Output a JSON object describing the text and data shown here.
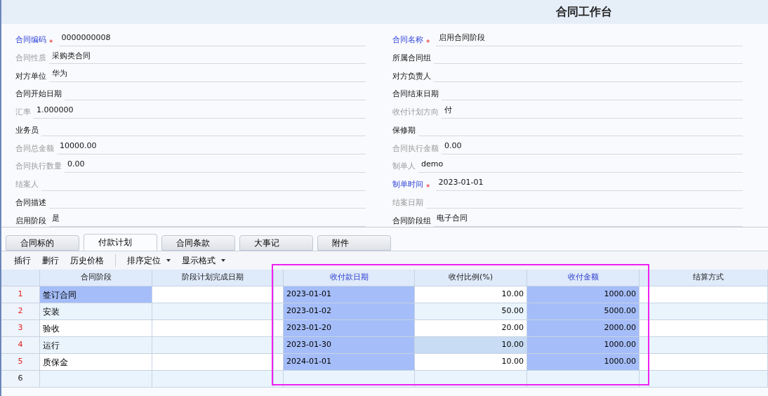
{
  "window": {
    "title": "合同工作台"
  },
  "form": {
    "left": [
      {
        "label": "合同编码",
        "kind": "required",
        "mark": "*",
        "value": "0000000008"
      },
      {
        "label": "合同性质",
        "kind": "readonly",
        "value": "采购类合同"
      },
      {
        "label": "对方单位",
        "kind": "normal",
        "value": "华为"
      },
      {
        "label": "合同开始日期",
        "kind": "normal"
      },
      {
        "label": "汇率",
        "kind": "readonly",
        "value": "1.000000"
      },
      {
        "label": "业务员",
        "kind": "normal"
      },
      {
        "label": "合同总金额",
        "kind": "readonly",
        "value": "10000.00"
      },
      {
        "label": "合同执行数量",
        "kind": "readonly",
        "value": "0.00"
      },
      {
        "label": "结案人",
        "kind": "readonly"
      },
      {
        "label": "合同描述",
        "kind": "normal"
      },
      {
        "label": "启用阶段",
        "kind": "normal",
        "value": "是"
      }
    ],
    "right": [
      {
        "label": "合同名称",
        "kind": "required",
        "mark": "*",
        "value": "启用合同阶段"
      },
      {
        "label": "所属合同组",
        "kind": "normal"
      },
      {
        "label": "对方负责人",
        "kind": "normal"
      },
      {
        "label": "合同结束日期",
        "kind": "normal"
      },
      {
        "label": "收付计划方向",
        "kind": "readonly",
        "value": "付"
      },
      {
        "label": "保修期",
        "kind": "normal"
      },
      {
        "label": "合同执行金额",
        "kind": "readonly",
        "value": "0.00"
      },
      {
        "label": "制单人",
        "kind": "readonly",
        "value": "demo"
      },
      {
        "label": "制单时间",
        "kind": "required",
        "mark": "*",
        "value": "2023-01-01"
      },
      {
        "label": "结案日期",
        "kind": "readonly"
      },
      {
        "label": "合同阶段组",
        "kind": "normal",
        "value": "电子合同"
      }
    ]
  },
  "tabs": [
    {
      "label": "合同标的",
      "selected": false
    },
    {
      "label": "付款计划",
      "selected": true
    },
    {
      "label": "合同条款",
      "selected": false
    },
    {
      "label": "大事记",
      "selected": false
    },
    {
      "label": "附件",
      "selected": false
    }
  ],
  "toolbar": [
    {
      "label": "插行",
      "kind": "button"
    },
    {
      "label": "删行",
      "kind": "button"
    },
    {
      "label": "历史价格",
      "kind": "button"
    },
    {
      "label": "排序定位",
      "kind": "dropdown"
    },
    {
      "label": "显示格式",
      "kind": "dropdown"
    }
  ],
  "table": {
    "columns": [
      {
        "label": "合同阶段",
        "required": false
      },
      {
        "label": "阶段计划完成日期",
        "required": false
      },
      {
        "label": "收付款日期",
        "required": true
      },
      {
        "label": "收付比例(%)",
        "required": false
      },
      {
        "label": "收付金额",
        "required": true
      },
      {
        "label": "结算方式",
        "required": false
      }
    ],
    "rows": [
      {
        "no": "1",
        "stage": "签订合同",
        "stage_selected": true,
        "pay_date": "2023-01-01",
        "ratio": "10.00",
        "ratio_selected": false,
        "amount": "1000.00"
      },
      {
        "no": "2",
        "stage": "安装",
        "stage_selected": false,
        "pay_date": "2023-01-02",
        "ratio": "50.00",
        "ratio_selected": false,
        "amount": "5000.00"
      },
      {
        "no": "3",
        "stage": "验收",
        "stage_selected": false,
        "pay_date": "2023-01-20",
        "ratio": "20.00",
        "ratio_selected": false,
        "amount": "2000.00"
      },
      {
        "no": "4",
        "stage": "运行",
        "stage_selected": false,
        "pay_date": "2023-01-30",
        "ratio": "10.00",
        "ratio_selected": true,
        "amount": "1000.00"
      },
      {
        "no": "5",
        "stage": "质保金",
        "stage_selected": false,
        "pay_date": "2024-01-01",
        "ratio": "10.00",
        "ratio_selected": false,
        "amount": "1000.00"
      },
      {
        "no": "6"
      }
    ]
  }
}
